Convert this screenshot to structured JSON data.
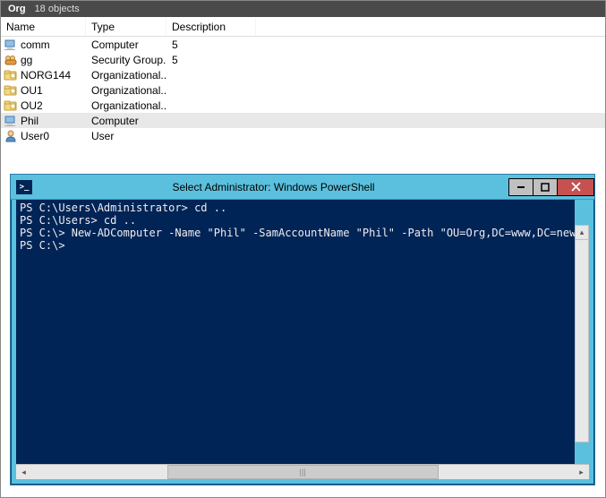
{
  "ad": {
    "title": "Org",
    "subtitle": "18 objects",
    "columns": {
      "name": "Name",
      "type": "Type",
      "desc": "Description"
    },
    "rows": [
      {
        "name": "comm",
        "type": "Computer",
        "desc": "5",
        "icon": "computer",
        "selected": false
      },
      {
        "name": "gg",
        "type": "Security Group...",
        "desc": "5",
        "icon": "group",
        "selected": false
      },
      {
        "name": "NORG144",
        "type": "Organizational...",
        "desc": "",
        "icon": "ou",
        "selected": false
      },
      {
        "name": "OU1",
        "type": "Organizational...",
        "desc": "",
        "icon": "ou",
        "selected": false
      },
      {
        "name": "OU2",
        "type": "Organizational...",
        "desc": "",
        "icon": "ou",
        "selected": false
      },
      {
        "name": "Phil",
        "type": "Computer",
        "desc": "",
        "icon": "computer",
        "selected": true
      },
      {
        "name": "User0",
        "type": "User",
        "desc": "",
        "icon": "user",
        "selected": false
      }
    ]
  },
  "ps": {
    "title": "Select Administrator: Windows PowerShell",
    "icon_glyph": ">_",
    "controls": {
      "min": "─",
      "max": "▢",
      "close": "✕"
    },
    "lines": [
      "PS C:\\Users\\Administrator> cd ..",
      "PS C:\\Users> cd ..",
      "PS C:\\> New-ADComputer -Name \"Phil\" -SamAccountName \"Phil\" -Path \"OU=Org,DC=www,DC=newlpd ,DC=com\"",
      "PS C:\\>"
    ],
    "scroll": {
      "up": "▴",
      "down": "▾",
      "left": "◂",
      "right": "▸",
      "thumb": "|||"
    }
  }
}
